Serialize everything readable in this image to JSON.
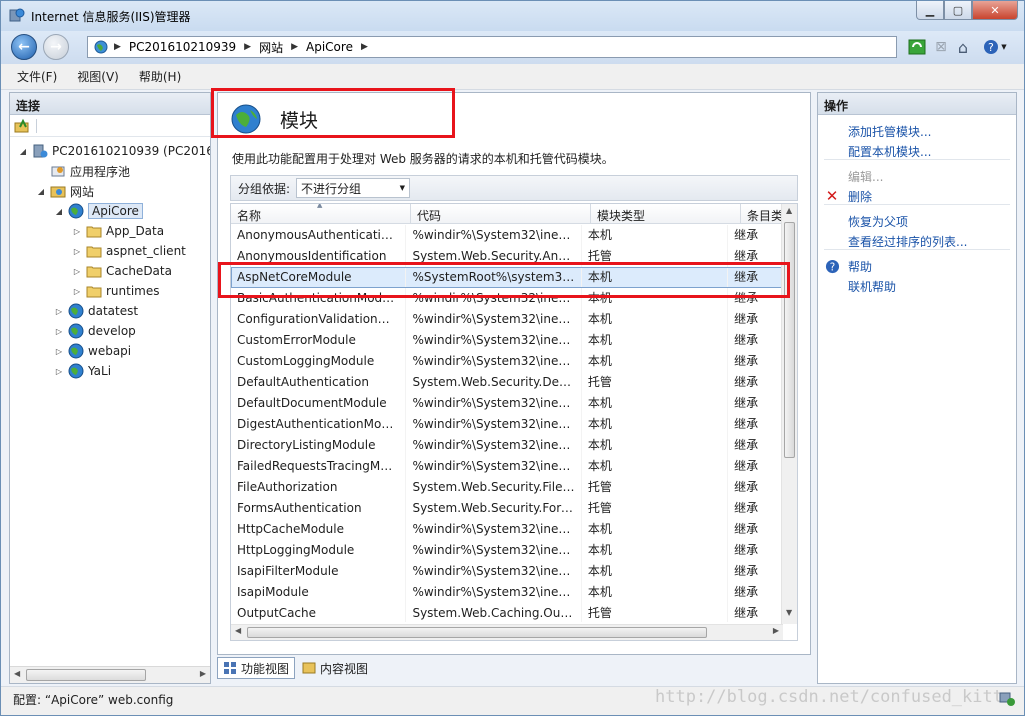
{
  "window": {
    "title": "Internet 信息服务(IIS)管理器"
  },
  "address": {
    "crumbs": [
      "PC201610210939",
      "网站",
      "ApiCore"
    ]
  },
  "menu": [
    "文件(F)",
    "视图(V)",
    "帮助(H)"
  ],
  "connections": {
    "header": "连接",
    "tree": [
      {
        "label": "PC201610210939 (PC20161",
        "level": 0,
        "expand": "◢",
        "icon": "server-icon"
      },
      {
        "label": "应用程序池",
        "level": 1,
        "expand": "",
        "icon": "app-pool-icon"
      },
      {
        "label": "网站",
        "level": 1,
        "expand": "◢",
        "icon": "sites-folder-icon"
      },
      {
        "label": "ApiCore",
        "level": 2,
        "expand": "◢",
        "icon": "globe-icon",
        "selected": true
      },
      {
        "label": "App_Data",
        "level": 3,
        "expand": "▷",
        "icon": "folder-icon"
      },
      {
        "label": "aspnet_client",
        "level": 3,
        "expand": "▷",
        "icon": "folder-icon"
      },
      {
        "label": "CacheData",
        "level": 3,
        "expand": "▷",
        "icon": "folder-icon"
      },
      {
        "label": "runtimes",
        "level": 3,
        "expand": "▷",
        "icon": "folder-icon"
      },
      {
        "label": "datatest",
        "level": 2,
        "expand": "▷",
        "icon": "globe-icon"
      },
      {
        "label": "develop",
        "level": 2,
        "expand": "▷",
        "icon": "globe-icon"
      },
      {
        "label": "webapi",
        "level": 2,
        "expand": "▷",
        "icon": "globe-icon"
      },
      {
        "label": "YaLi",
        "level": 2,
        "expand": "▷",
        "icon": "globe-icon"
      }
    ]
  },
  "feature": {
    "title": "模块",
    "description": "使用此功能配置用于处理对 Web 服务器的请求的本机和托管代码模块。",
    "group_label": "分组依据:",
    "group_value": "不进行分组",
    "columns": [
      "名称",
      "代码",
      "模块类型",
      "条目类"
    ],
    "rows": [
      [
        "AnonymousAuthentication...",
        "%windir%\\System32\\inetsr...",
        "本机",
        "继承"
      ],
      [
        "AnonymousIdentification",
        "System.Web.Security.Anon...",
        "托管",
        "继承"
      ],
      [
        "AspNetCoreModule",
        "%SystemRoot%\\system32\\...",
        "本机",
        "继承"
      ],
      [
        "BasicAuthenticationModule",
        "%windir%\\System32\\inetsr...",
        "本机",
        "继承"
      ],
      [
        "ConfigurationValidationMo...",
        "%windir%\\System32\\inetsr...",
        "本机",
        "继承"
      ],
      [
        "CustomErrorModule",
        "%windir%\\System32\\inetsr...",
        "本机",
        "继承"
      ],
      [
        "CustomLoggingModule",
        "%windir%\\System32\\inetsr...",
        "本机",
        "继承"
      ],
      [
        "DefaultAuthentication",
        "System.Web.Security.Defau...",
        "托管",
        "继承"
      ],
      [
        "DefaultDocumentModule",
        "%windir%\\System32\\inetsr...",
        "本机",
        "继承"
      ],
      [
        "DigestAuthenticationModule",
        "%windir%\\System32\\inetsr...",
        "本机",
        "继承"
      ],
      [
        "DirectoryListingModule",
        "%windir%\\System32\\inetsr...",
        "本机",
        "继承"
      ],
      [
        "FailedRequestsTracingMod...",
        "%windir%\\System32\\inetsr...",
        "本机",
        "继承"
      ],
      [
        "FileAuthorization",
        "System.Web.Security.FileAu...",
        "托管",
        "继承"
      ],
      [
        "FormsAuthentication",
        "System.Web.Security.Form...",
        "托管",
        "继承"
      ],
      [
        "HttpCacheModule",
        "%windir%\\System32\\inetsr...",
        "本机",
        "继承"
      ],
      [
        "HttpLoggingModule",
        "%windir%\\System32\\inetsr...",
        "本机",
        "继承"
      ],
      [
        "IsapiFilterModule",
        "%windir%\\System32\\inetsr...",
        "本机",
        "继承"
      ],
      [
        "IsapiModule",
        "%windir%\\System32\\inetsr...",
        "本机",
        "继承"
      ],
      [
        "OutputCache",
        "System.Web.Caching.Outp...",
        "托管",
        "继承"
      ]
    ],
    "selected_row": 2
  },
  "view_tabs": [
    "功能视图",
    "内容视图"
  ],
  "actions": {
    "header": "操作",
    "items": [
      {
        "label": "添加托管模块...",
        "enabled": true,
        "icon": ""
      },
      {
        "label": "配置本机模块...",
        "enabled": true,
        "icon": ""
      },
      {
        "label": "编辑...",
        "enabled": false,
        "icon": ""
      },
      {
        "label": "删除",
        "enabled": true,
        "icon": "delete-icon"
      },
      {
        "label": "恢复为父项",
        "enabled": true,
        "icon": ""
      },
      {
        "label": "查看经过排序的列表...",
        "enabled": true,
        "icon": ""
      },
      {
        "label": "帮助",
        "enabled": true,
        "icon": "help-icon"
      },
      {
        "label": "联机帮助",
        "enabled": true,
        "icon": ""
      }
    ]
  },
  "status": {
    "text": "配置: “ApiCore” web.config",
    "watermark": "http://blog.csdn.net/confused_kitt"
  },
  "colors": {
    "highlight": "#e8141b",
    "link": "#1a53a8",
    "selection": "#dcebfc"
  }
}
